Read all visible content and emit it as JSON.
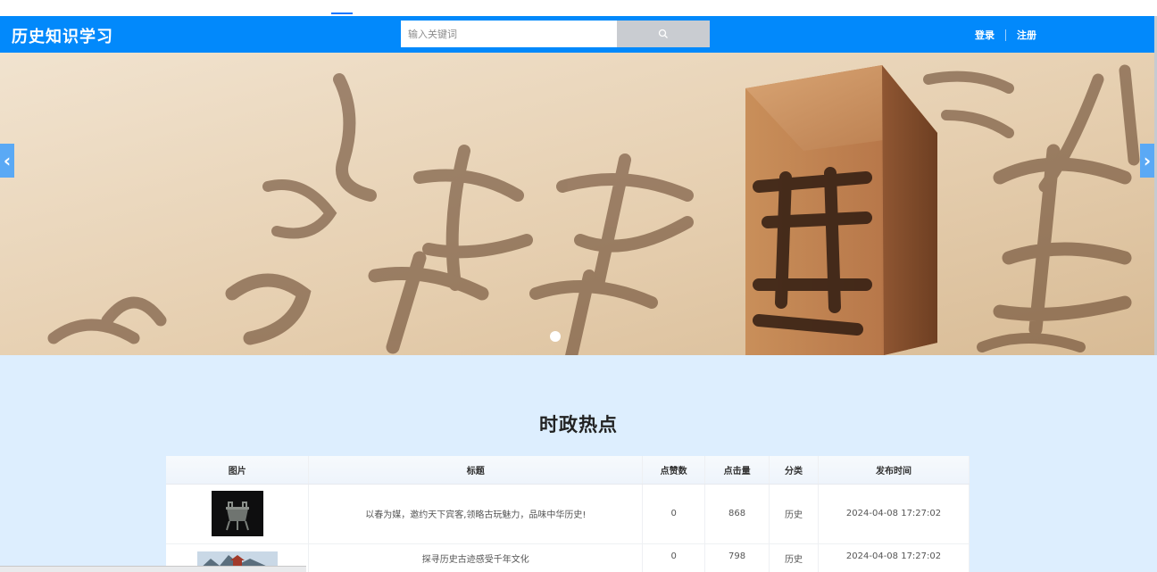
{
  "header": {
    "brand": "历史知识学习",
    "search_placeholder": "输入关键词",
    "login": "登录",
    "register": "注册"
  },
  "banner": {
    "slide_count": 1,
    "active_slide": 0
  },
  "section": {
    "title": "时政热点"
  },
  "table": {
    "columns": [
      "图片",
      "标题",
      "点赞数",
      "点击量",
      "分类",
      "发布时间"
    ],
    "rows": [
      {
        "title": "以春为媒，邀约天下宾客,领略古玩魅力，品味中华历史!",
        "likes": "0",
        "clicks": "868",
        "category": "历史",
        "published": "2024-04-08 17:27:02"
      },
      {
        "title": "探寻历史古迹感受千年文化",
        "likes": "0",
        "clicks": "798",
        "category": "历史",
        "published": "2024-04-08 17:27:02"
      }
    ]
  },
  "icons": {
    "search": "search-icon",
    "prev": "chevron-left-icon",
    "next": "chevron-right-icon"
  },
  "colors": {
    "navbar": "#0289fb",
    "content_bg": "#ddeefe",
    "search_button": "#c9ccd1"
  }
}
